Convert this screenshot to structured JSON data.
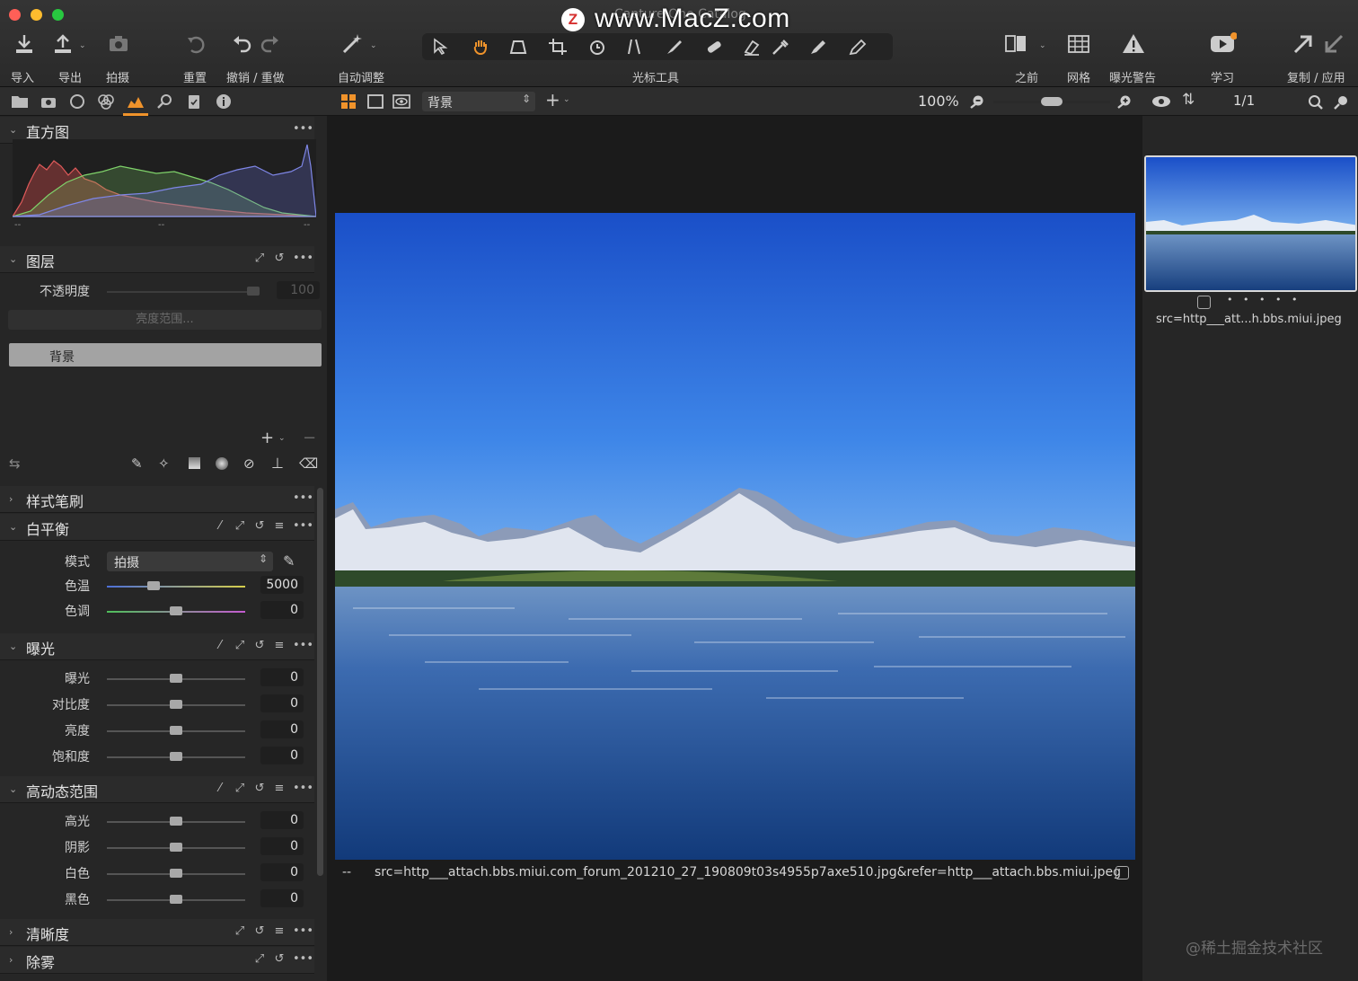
{
  "window": {
    "title": "Capture One Catalog",
    "watermark": "www.MacZ.com",
    "logo_letter": "Z"
  },
  "toolbar": {
    "import": "导入",
    "export": "导出",
    "capture": "拍摄",
    "reset": "重置",
    "undo_redo": "撤销 / 重做",
    "auto_adjust": "自动调整",
    "cursor_tools": "光标工具",
    "before": "之前",
    "grid": "网格",
    "exposure_warning": "曝光警告",
    "learn": "学习",
    "copy_apply": "复制 / 应用"
  },
  "histogram": {
    "title": "直方图",
    "min_label": "--",
    "mid_label": "--",
    "max_label": "--"
  },
  "layers": {
    "title": "图层",
    "opacity_label": "不透明度",
    "opacity_value": "100",
    "luma_range": "亮度范围...",
    "layer_name": "背景"
  },
  "style_brush": {
    "title": "样式笔刷"
  },
  "white_balance": {
    "title": "白平衡",
    "mode_label": "模式",
    "mode_value": "拍摄",
    "kelvin_label": "色温",
    "kelvin_value": "5000",
    "tint_label": "色调",
    "tint_value": "0",
    "kelvin_level": 0.34,
    "tint_level": 0.5
  },
  "exposure": {
    "title": "曝光",
    "rows": [
      {
        "label": "曝光",
        "value": "0",
        "level": 0.5
      },
      {
        "label": "对比度",
        "value": "0",
        "level": 0.5
      },
      {
        "label": "亮度",
        "value": "0",
        "level": 0.5
      },
      {
        "label": "饱和度",
        "value": "0",
        "level": 0.5
      }
    ]
  },
  "hdr": {
    "title": "高动态范围",
    "rows": [
      {
        "label": "高光",
        "value": "0",
        "level": 0.5
      },
      {
        "label": "阴影",
        "value": "0",
        "level": 0.5
      },
      {
        "label": "白色",
        "value": "0",
        "level": 0.5
      },
      {
        "label": "黑色",
        "value": "0",
        "level": 0.5
      }
    ]
  },
  "clarity": {
    "title": "清晰度"
  },
  "dehaze": {
    "title": "除雾"
  },
  "viewer": {
    "layer_select": "背景",
    "zoom": "100%",
    "zoom_level": 0.5,
    "caption_prefix": "--",
    "filename": "src=http___attach.bbs.miui.com_forum_201210_27_190809t03s4955p7axe510.jpg&refer=http___attach.bbs.miui.jpeg"
  },
  "browser": {
    "count": "1/1",
    "thumb_name": "src=http___att...h.bbs.miui.jpeg",
    "rating_dots": "• • • • •"
  },
  "corner_watermark": "@稀土掘金技术社区",
  "colors": {
    "accent_orange": "#f0932b",
    "panel": "#262626",
    "toolbar": "#2f2f2f"
  }
}
